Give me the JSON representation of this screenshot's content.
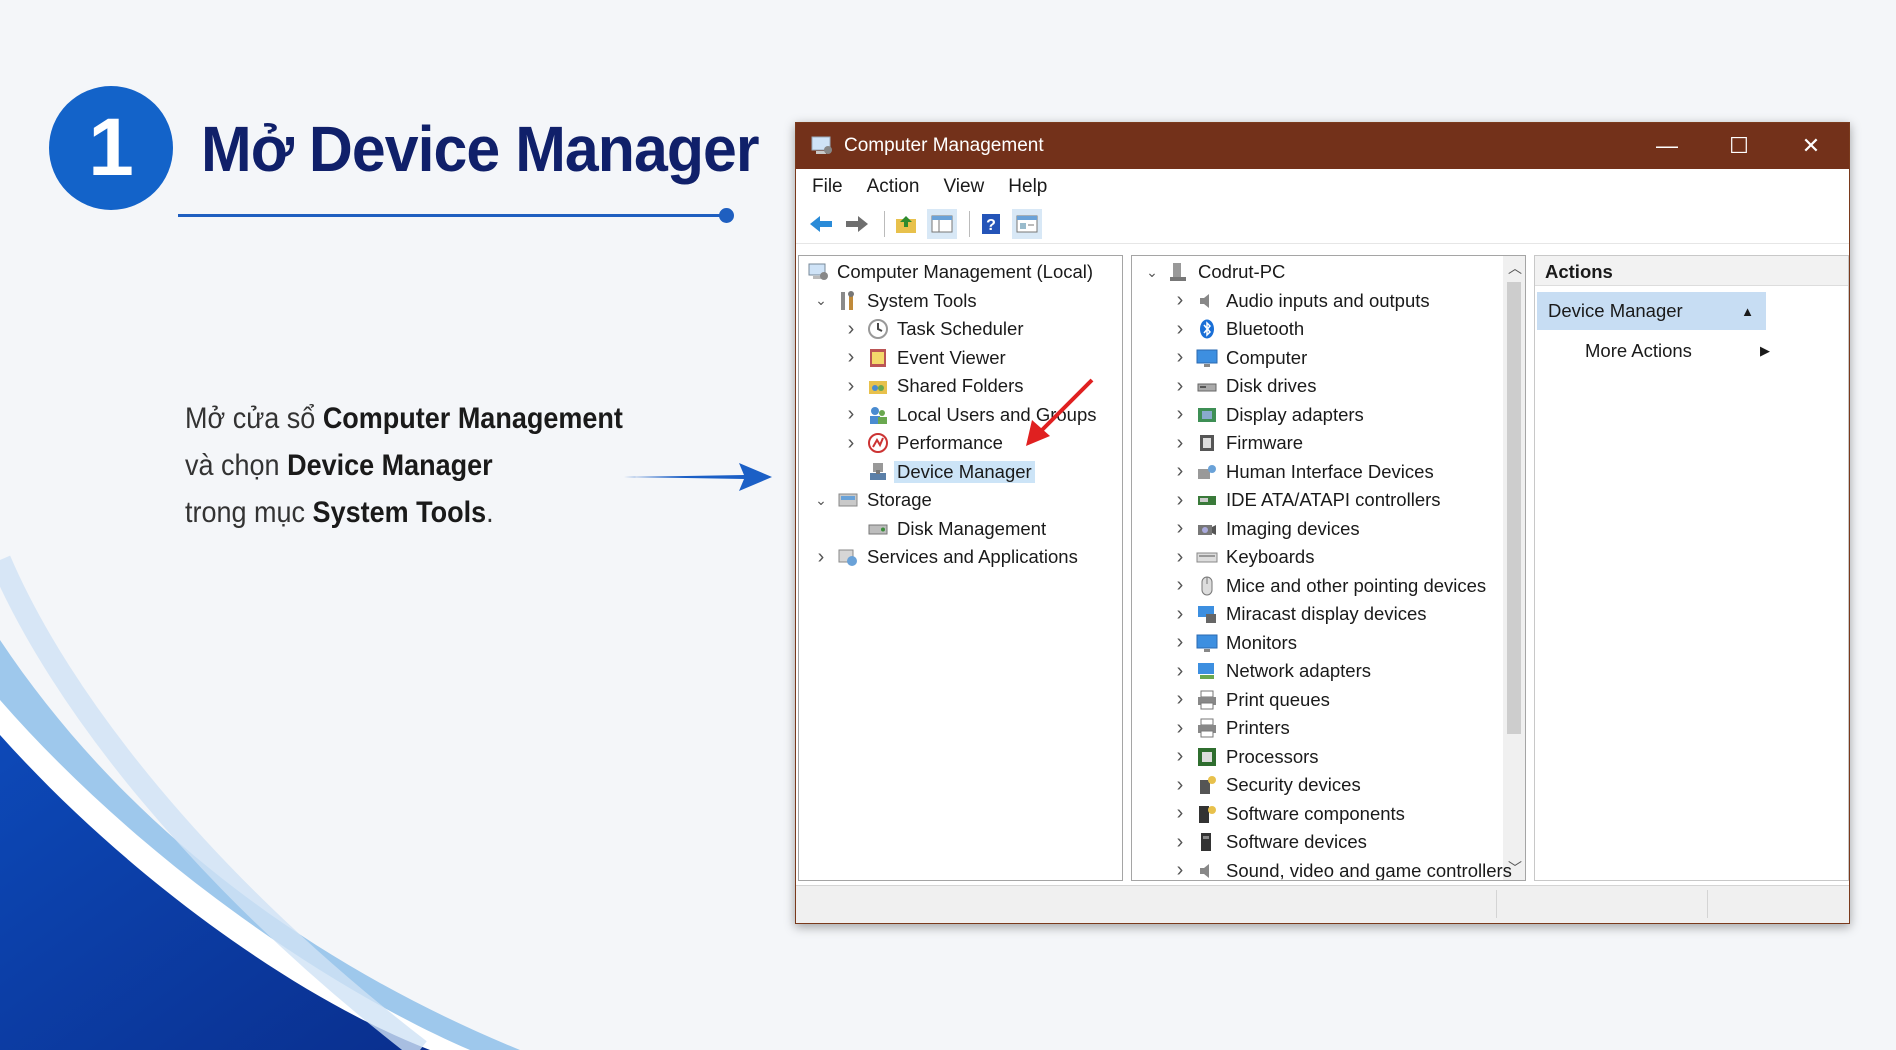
{
  "slide": {
    "step_number": "1",
    "title": "Mở Device Manager",
    "description": {
      "l1a": "Mở cửa sổ ",
      "l1b": "Computer Management",
      "l2a": "và chọn ",
      "l2b": "Device Manager",
      "l3a": "trong mục ",
      "l3b": "System Tools",
      "l3c": "."
    },
    "colors": {
      "accent": "#1363c9",
      "title": "#10206a",
      "titlebar": "#73311a",
      "pointer_arrow": "#e02020"
    }
  },
  "window": {
    "title": "Computer Management",
    "controls": {
      "minimize": "—",
      "maximize": "☐",
      "close": "✕"
    },
    "menu": [
      "File",
      "Action",
      "View",
      "Help"
    ],
    "toolbar_icons": [
      "back-arrow-icon",
      "forward-arrow-icon",
      "up-folder-icon",
      "show-hide-tree-icon",
      "help-icon",
      "properties-icon"
    ]
  },
  "left_tree": [
    {
      "label": "Computer Management (Local)",
      "level": 0,
      "expander": "none",
      "icon": "computer-management-icon"
    },
    {
      "label": "System Tools",
      "level": 1,
      "expander": "expanded",
      "icon": "tools-icon"
    },
    {
      "label": "Task Scheduler",
      "level": 2,
      "expander": "collapsed",
      "icon": "clock-icon"
    },
    {
      "label": "Event Viewer",
      "level": 2,
      "expander": "collapsed",
      "icon": "event-viewer-icon"
    },
    {
      "label": "Shared Folders",
      "level": 2,
      "expander": "collapsed",
      "icon": "shared-folder-icon"
    },
    {
      "label": "Local Users and Groups",
      "level": 2,
      "expander": "collapsed",
      "icon": "users-icon"
    },
    {
      "label": "Performance",
      "level": 2,
      "expander": "collapsed",
      "icon": "performance-icon"
    },
    {
      "label": "Device Manager",
      "level": 2,
      "expander": "none",
      "icon": "device-manager-icon",
      "selected": true
    },
    {
      "label": "Storage",
      "level": 1,
      "expander": "expanded",
      "icon": "storage-icon"
    },
    {
      "label": "Disk Management",
      "level": 2,
      "expander": "none",
      "icon": "disk-management-icon"
    },
    {
      "label": "Services and Applications",
      "level": 1,
      "expander": "collapsed",
      "icon": "services-icon"
    }
  ],
  "device_tree": {
    "root": "Codrut-PC",
    "categories": [
      {
        "label": "Audio inputs and outputs",
        "icon": "speaker-icon"
      },
      {
        "label": "Bluetooth",
        "icon": "bluetooth-icon"
      },
      {
        "label": "Computer",
        "icon": "monitor-icon"
      },
      {
        "label": "Disk drives",
        "icon": "disk-drive-icon"
      },
      {
        "label": "Display adapters",
        "icon": "display-adapter-icon"
      },
      {
        "label": "Firmware",
        "icon": "firmware-icon"
      },
      {
        "label": "Human Interface Devices",
        "icon": "hid-icon"
      },
      {
        "label": "IDE ATA/ATAPI controllers",
        "icon": "ide-controller-icon"
      },
      {
        "label": "Imaging devices",
        "icon": "camera-icon"
      },
      {
        "label": "Keyboards",
        "icon": "keyboard-icon"
      },
      {
        "label": "Mice and other pointing devices",
        "icon": "mouse-icon"
      },
      {
        "label": "Miracast display devices",
        "icon": "miracast-icon"
      },
      {
        "label": "Monitors",
        "icon": "monitor-icon"
      },
      {
        "label": "Network adapters",
        "icon": "network-adapter-icon"
      },
      {
        "label": "Print queues",
        "icon": "printer-icon"
      },
      {
        "label": "Printers",
        "icon": "printer-icon"
      },
      {
        "label": "Processors",
        "icon": "processor-icon"
      },
      {
        "label": "Security devices",
        "icon": "security-device-icon"
      },
      {
        "label": "Software components",
        "icon": "software-component-icon"
      },
      {
        "label": "Software devices",
        "icon": "software-device-icon"
      },
      {
        "label": "Sound, video and game controllers",
        "icon": "speaker-icon"
      }
    ]
  },
  "actions_pane": {
    "header": "Actions",
    "section": "Device Manager",
    "items": [
      "More Actions"
    ]
  }
}
